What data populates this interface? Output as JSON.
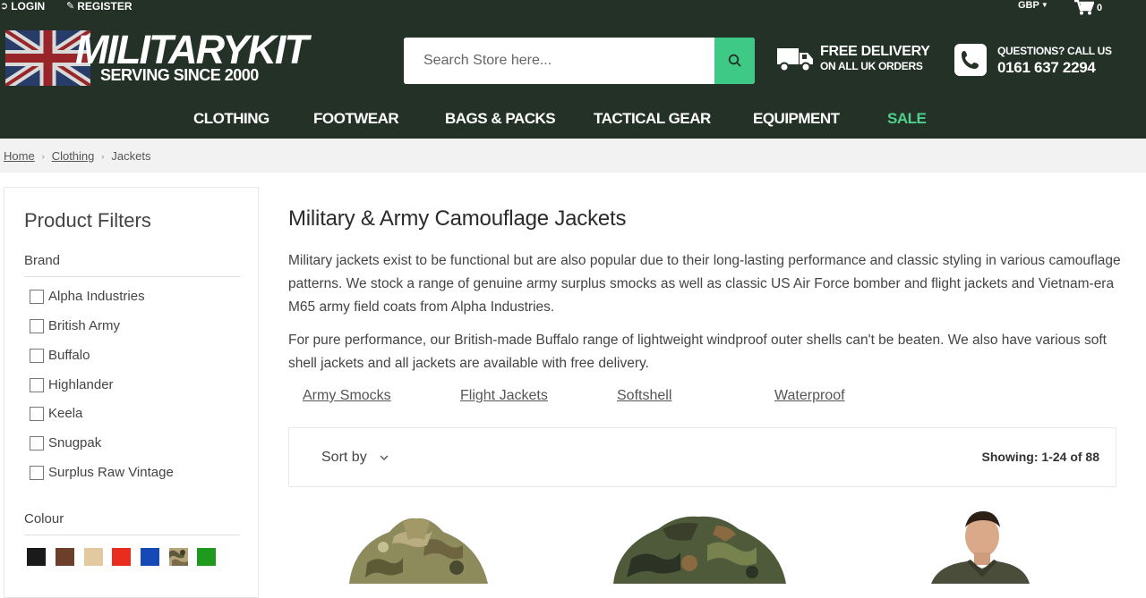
{
  "topbar": {
    "login": "LOGIN",
    "register": "REGISTER",
    "currency": "GBP",
    "cart_count": "0"
  },
  "logo": {
    "title": "MILITARYKIT",
    "subtitle": "SERVING SINCE 2000"
  },
  "search": {
    "placeholder": "Search Store here..."
  },
  "promo": {
    "delivery_line1": "FREE DELIVERY",
    "delivery_line2": "ON ALL UK ORDERS",
    "questions_line1": "QUESTIONS? CALL US",
    "questions_line2": "0161 637 2294"
  },
  "nav": {
    "items": [
      "CLOTHING",
      "FOOTWEAR",
      "BAGS & PACKS",
      "TACTICAL GEAR",
      "EQUIPMENT",
      "SALE"
    ]
  },
  "breadcrumb": {
    "home": "Home",
    "clothing": "Clothing",
    "current": "Jackets"
  },
  "filters": {
    "title": "Product Filters",
    "brand_title": "Brand",
    "brands": [
      "Alpha Industries",
      "British Army",
      "Buffalo",
      "Highlander",
      "Keela",
      "Snugpak",
      "Surplus Raw Vintage"
    ],
    "colour_title": "Colour",
    "colours": [
      "#1a1a1a",
      "#6b3f2a",
      "#e3c9a0",
      "#e82c1e",
      "#1748b8",
      "camo",
      "#1f9a1f"
    ]
  },
  "main": {
    "title": "Military & Army Camouflage Jackets",
    "desc1": "Military jackets exist to be functional but are also popular due to their long-lasting performance and classic styling in various camouflage patterns. We stock a range of genuine army surplus smocks as well as classic US Air Force bomber and flight jackets and Vietnam-era M65 army field coats from Alpha Industries.",
    "desc2": "For pure performance, our British-made Buffalo range of lightweight windproof outer shells can't be beaten. We also have various soft shell jackets and all jackets are available with free delivery.",
    "sublinks": [
      "Army Smocks",
      "Flight Jackets",
      "Softshell",
      "Waterproof"
    ],
    "sort_label": "Sort by",
    "showing": "Showing: 1-24 of 88"
  }
}
